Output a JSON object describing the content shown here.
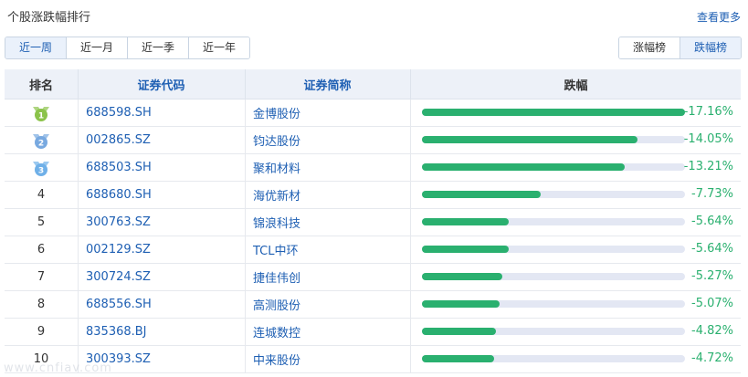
{
  "header": {
    "title": "个股涨跌幅排行",
    "more_label": "查看更多"
  },
  "period_tabs": [
    {
      "label": "近一周",
      "active": true
    },
    {
      "label": "近一月",
      "active": false
    },
    {
      "label": "近一季",
      "active": false
    },
    {
      "label": "近一年",
      "active": false
    }
  ],
  "rank_tabs": [
    {
      "label": "涨幅榜",
      "active": false
    },
    {
      "label": "跌幅榜",
      "active": true
    }
  ],
  "table": {
    "columns": [
      "排名",
      "证券代码",
      "证券简称",
      "跌幅"
    ],
    "max_abs_change": 17.16,
    "rows": [
      {
        "rank": "1",
        "code": "688598.SH",
        "name": "金博股份",
        "change": "-17.16%",
        "value": -17.16
      },
      {
        "rank": "2",
        "code": "002865.SZ",
        "name": "钧达股份",
        "change": "-14.05%",
        "value": -14.05
      },
      {
        "rank": "3",
        "code": "688503.SH",
        "name": "聚和材料",
        "change": "-13.21%",
        "value": -13.21
      },
      {
        "rank": "4",
        "code": "688680.SH",
        "name": "海优新材",
        "change": "-7.73%",
        "value": -7.73
      },
      {
        "rank": "5",
        "code": "300763.SZ",
        "name": "锦浪科技",
        "change": "-5.64%",
        "value": -5.64
      },
      {
        "rank": "6",
        "code": "002129.SZ",
        "name": "TCL中环",
        "change": "-5.64%",
        "value": -5.64
      },
      {
        "rank": "7",
        "code": "300724.SZ",
        "name": "捷佳伟创",
        "change": "-5.27%",
        "value": -5.27
      },
      {
        "rank": "8",
        "code": "688556.SH",
        "name": "高测股份",
        "change": "-5.07%",
        "value": -5.07
      },
      {
        "rank": "9",
        "code": "835368.BJ",
        "name": "连城数控",
        "change": "-4.82%",
        "value": -4.82
      },
      {
        "rank": "10",
        "code": "300393.SZ",
        "name": "中来股份",
        "change": "-4.72%",
        "value": -4.72
      }
    ]
  },
  "colors": {
    "accent": "#1e5fb3",
    "bar_fill": "#2ab06f",
    "bar_track": "#e3e7f3",
    "medal_gold": "#8bc34a",
    "medal_silver": "#78a9e0",
    "medal_bronze": "#6fb0e8"
  }
}
